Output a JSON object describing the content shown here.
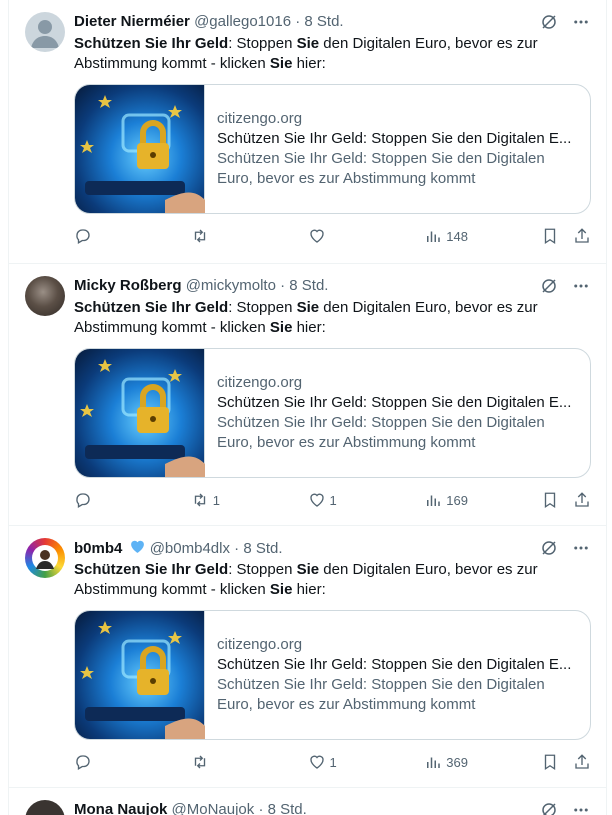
{
  "tweets": [
    {
      "name": "Dieter Nierméier",
      "handle": "@gallego1016",
      "time": "8 Std.",
      "text": [
        {
          "t": "Schützen Sie Ihr Geld",
          "b": true
        },
        {
          "t": ": Stoppen ",
          "b": false
        },
        {
          "t": "Sie",
          "b": true
        },
        {
          "t": " den Digitalen Euro, bevor es zur Abstimmung kommt - klicken ",
          "b": false
        },
        {
          "t": "Sie",
          "b": true
        },
        {
          "t": " hier:",
          "b": false
        }
      ],
      "card": {
        "domain": "citizengo.org",
        "title": "Schützen Sie Ihr Geld: Stoppen Sie den Digitalen E...",
        "description": "Schützen Sie Ihr Geld: Stoppen Sie den Digitalen Euro, bevor es zur Abstimmung kommt"
      },
      "replies": "",
      "retweets": "",
      "likes": "",
      "views": "148"
    },
    {
      "name": "Micky Roßberg",
      "handle": "@mickymolto",
      "time": "8 Std.",
      "text": [
        {
          "t": "Schützen Sie Ihr Geld",
          "b": true
        },
        {
          "t": ": Stoppen ",
          "b": false
        },
        {
          "t": "Sie",
          "b": true
        },
        {
          "t": " den Digitalen Euro, bevor es zur Abstimmung kommt - klicken ",
          "b": false
        },
        {
          "t": "Sie",
          "b": true
        },
        {
          "t": " hier:",
          "b": false
        }
      ],
      "card": {
        "domain": "citizengo.org",
        "title": "Schützen Sie Ihr Geld: Stoppen Sie den Digitalen E...",
        "description": "Schützen Sie Ihr Geld: Stoppen Sie den Digitalen Euro, bevor es zur Abstimmung kommt"
      },
      "replies": "",
      "retweets": "1",
      "likes": "1",
      "views": "169"
    },
    {
      "name": "b0mb4",
      "handle": "@b0mb4dlx",
      "time": "8 Std.",
      "text": [
        {
          "t": "Schützen Sie Ihr Geld",
          "b": true
        },
        {
          "t": ": Stoppen ",
          "b": false
        },
        {
          "t": "Sie",
          "b": true
        },
        {
          "t": " den Digitalen Euro, bevor es zur Abstimmung kommt - klicken ",
          "b": false
        },
        {
          "t": "Sie",
          "b": true
        },
        {
          "t": " hier:",
          "b": false
        }
      ],
      "card": {
        "domain": "citizengo.org",
        "title": "Schützen Sie Ihr Geld: Stoppen Sie den Digitalen E...",
        "description": "Schützen Sie Ihr Geld: Stoppen Sie den Digitalen Euro, bevor es zur Abstimmung kommt"
      },
      "replies": "",
      "retweets": "",
      "likes": "1",
      "views": "369"
    },
    {
      "name": "Mona Naujok",
      "handle": "@MoNaujok",
      "time": "8 Std."
    }
  ],
  "colors": {
    "text": "#0f1419",
    "muted": "#536471",
    "border": "#cfd9de",
    "divider": "#eff3f4",
    "verified": "#1d9bf0"
  }
}
